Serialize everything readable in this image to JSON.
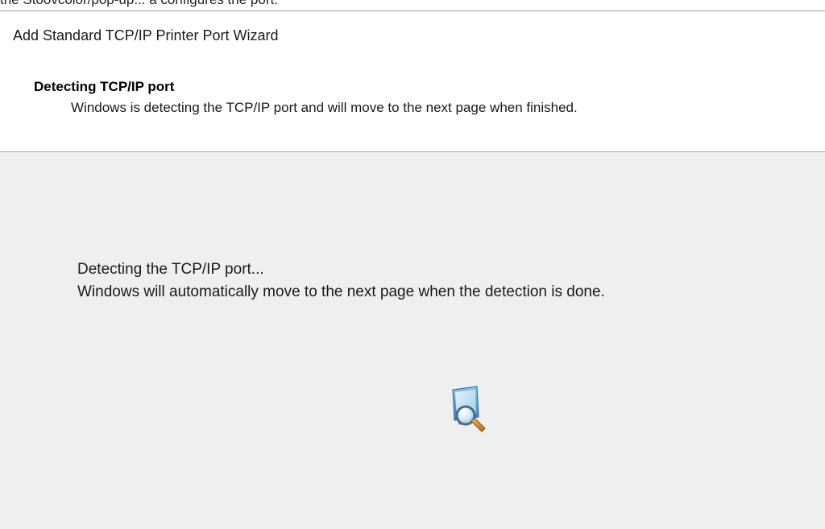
{
  "top_fragment": "the Stoovcolor/pop-up... a configures the port.",
  "wizard": {
    "title": "Add Standard TCP/IP Printer Port Wizard"
  },
  "header": {
    "heading": "Detecting TCP/IP port",
    "subheading": "Windows is detecting the TCP/IP port and will move to the next page when finished."
  },
  "body": {
    "line1": "Detecting the TCP/IP port...",
    "line2": "Windows will automatically move to the next page when the detection is done."
  },
  "icons": {
    "detecting": "search-computer-icon"
  },
  "colors": {
    "body_background": "#efefef",
    "header_background": "#ffffff",
    "divider": "#a8a8a8"
  }
}
